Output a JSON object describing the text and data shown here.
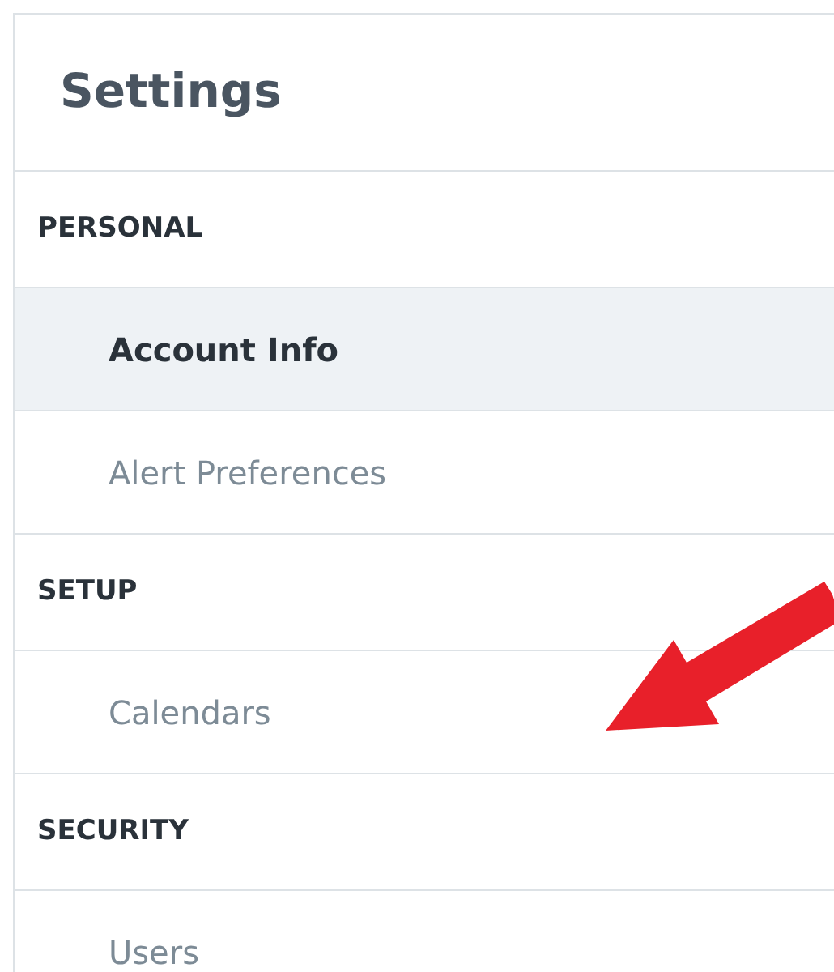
{
  "title": "Settings",
  "sections": [
    {
      "label": "PERSONAL",
      "items": [
        {
          "label": "Account Info",
          "selected": true
        },
        {
          "label": "Alert Preferences",
          "selected": false
        }
      ]
    },
    {
      "label": "SETUP",
      "items": [
        {
          "label": "Calendars",
          "selected": false
        }
      ]
    },
    {
      "label": "SECURITY",
      "items": [
        {
          "label": "Users",
          "selected": false
        }
      ]
    }
  ]
}
